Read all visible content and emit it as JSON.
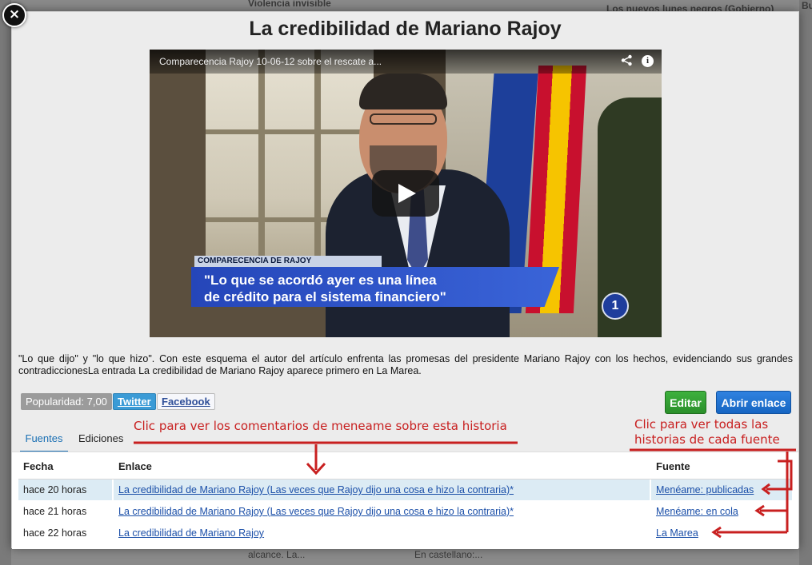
{
  "background": {
    "texts": [
      "Violencia invisible",
      "Los nuevos lunes negros (Gobierno)",
      "Bu",
      "alcance. La...",
      "En castellano:..."
    ]
  },
  "modal": {
    "close_label": "×",
    "title": "La credibilidad de Mariano Rajoy"
  },
  "video": {
    "title": "Comparecencia Rajoy 10-06-12 sobre el rescate a...",
    "lower_third_label": "COMPARECENCIA DE RAJOY",
    "lower_third_quote_line1": "\"Lo que se acordó ayer es una línea",
    "lower_third_quote_line2": "de crédito para el sistema financiero\"",
    "channel_logo": "1",
    "share_icon": "share-icon",
    "info_icon": "info-icon"
  },
  "description": "\"Lo que dijo\" y \"lo que hizo\". Con este esquema el autor del artículo enfrenta las promesas del presidente Mariano Rajoy con los hechos, evidenciando sus grandes contradiccionesLa entrada La credibilidad de Mariano Rajoy aparece primero en La Marea.",
  "actions": {
    "popularity": "Popularidad: 7,00",
    "twitter": "Twitter",
    "facebook": "Facebook",
    "edit": "Editar",
    "open_link": "Abrir enlace"
  },
  "tabs": [
    {
      "label": "Fuentes",
      "active": true
    },
    {
      "label": "Ediciones",
      "active": false
    }
  ],
  "table": {
    "headers": {
      "date": "Fecha",
      "link": "Enlace",
      "source": "Fuente"
    },
    "rows": [
      {
        "date": "hace 20 horas",
        "link": "La credibilidad de Mariano Rajoy (Las veces que Rajoy dijo una cosa e hizo la contraria)*",
        "source": "Menéame: publicadas"
      },
      {
        "date": "hace 21 horas",
        "link": "La credibilidad de Mariano Rajoy (Las veces que Rajoy dijo una cosa e hizo la contraria)*",
        "source": "Menéame: en cola"
      },
      {
        "date": "hace 22 horas",
        "link": "La credibilidad de Mariano Rajoy",
        "source": "La Marea"
      }
    ]
  },
  "annotations": {
    "comments_hint": "Clic para ver los comentarios de meneame sobre esta historia",
    "sources_hint_line1": "Clic para ver todas las",
    "sources_hint_line2": "historias de cada fuente"
  },
  "colors": {
    "annotation": "#c82020",
    "link": "#1b4fa8",
    "edit_button": "#2a8f2a",
    "open_button": "#1665c2",
    "row_highlight": "#dcebf4"
  }
}
